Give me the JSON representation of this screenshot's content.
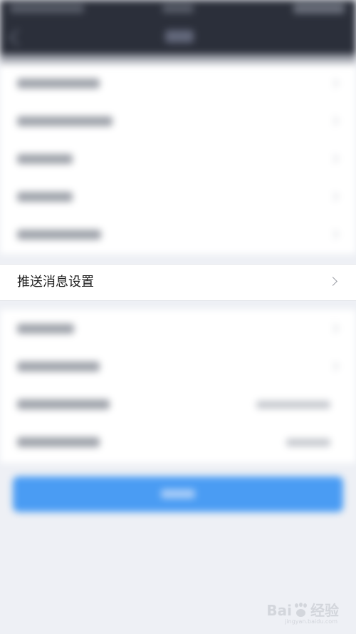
{
  "push_settings": {
    "label": "推送消息设置"
  },
  "watermark": {
    "brand_left": "Bai",
    "brand_right": "经验",
    "url": "jingyan.baidu.com"
  },
  "colors": {
    "header_bg": "#2b2f3a",
    "page_bg": "#eef0f5",
    "primary_button": "#4a9cf3"
  },
  "icons": {
    "back": "back-icon",
    "row_chevron": "chevron-right-icon",
    "watermark": "paw-icon"
  }
}
